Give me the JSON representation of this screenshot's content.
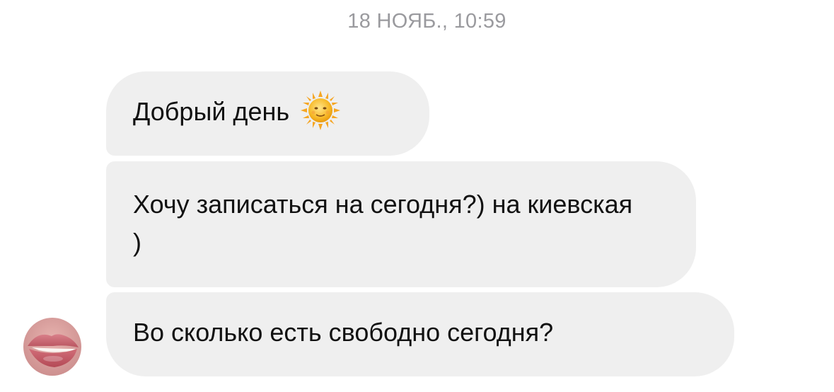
{
  "thread": {
    "timestamp": "18 НОЯБ., 10:59"
  },
  "messages": [
    {
      "text": "Добрый день",
      "emoji": "sun-with-face-icon"
    },
    {
      "text": "Хочу записаться на сегодня?) на киевская )"
    },
    {
      "text": "Во сколько есть свободно сегодня?"
    }
  ],
  "sender": {
    "avatar_icon": "lips-avatar"
  }
}
